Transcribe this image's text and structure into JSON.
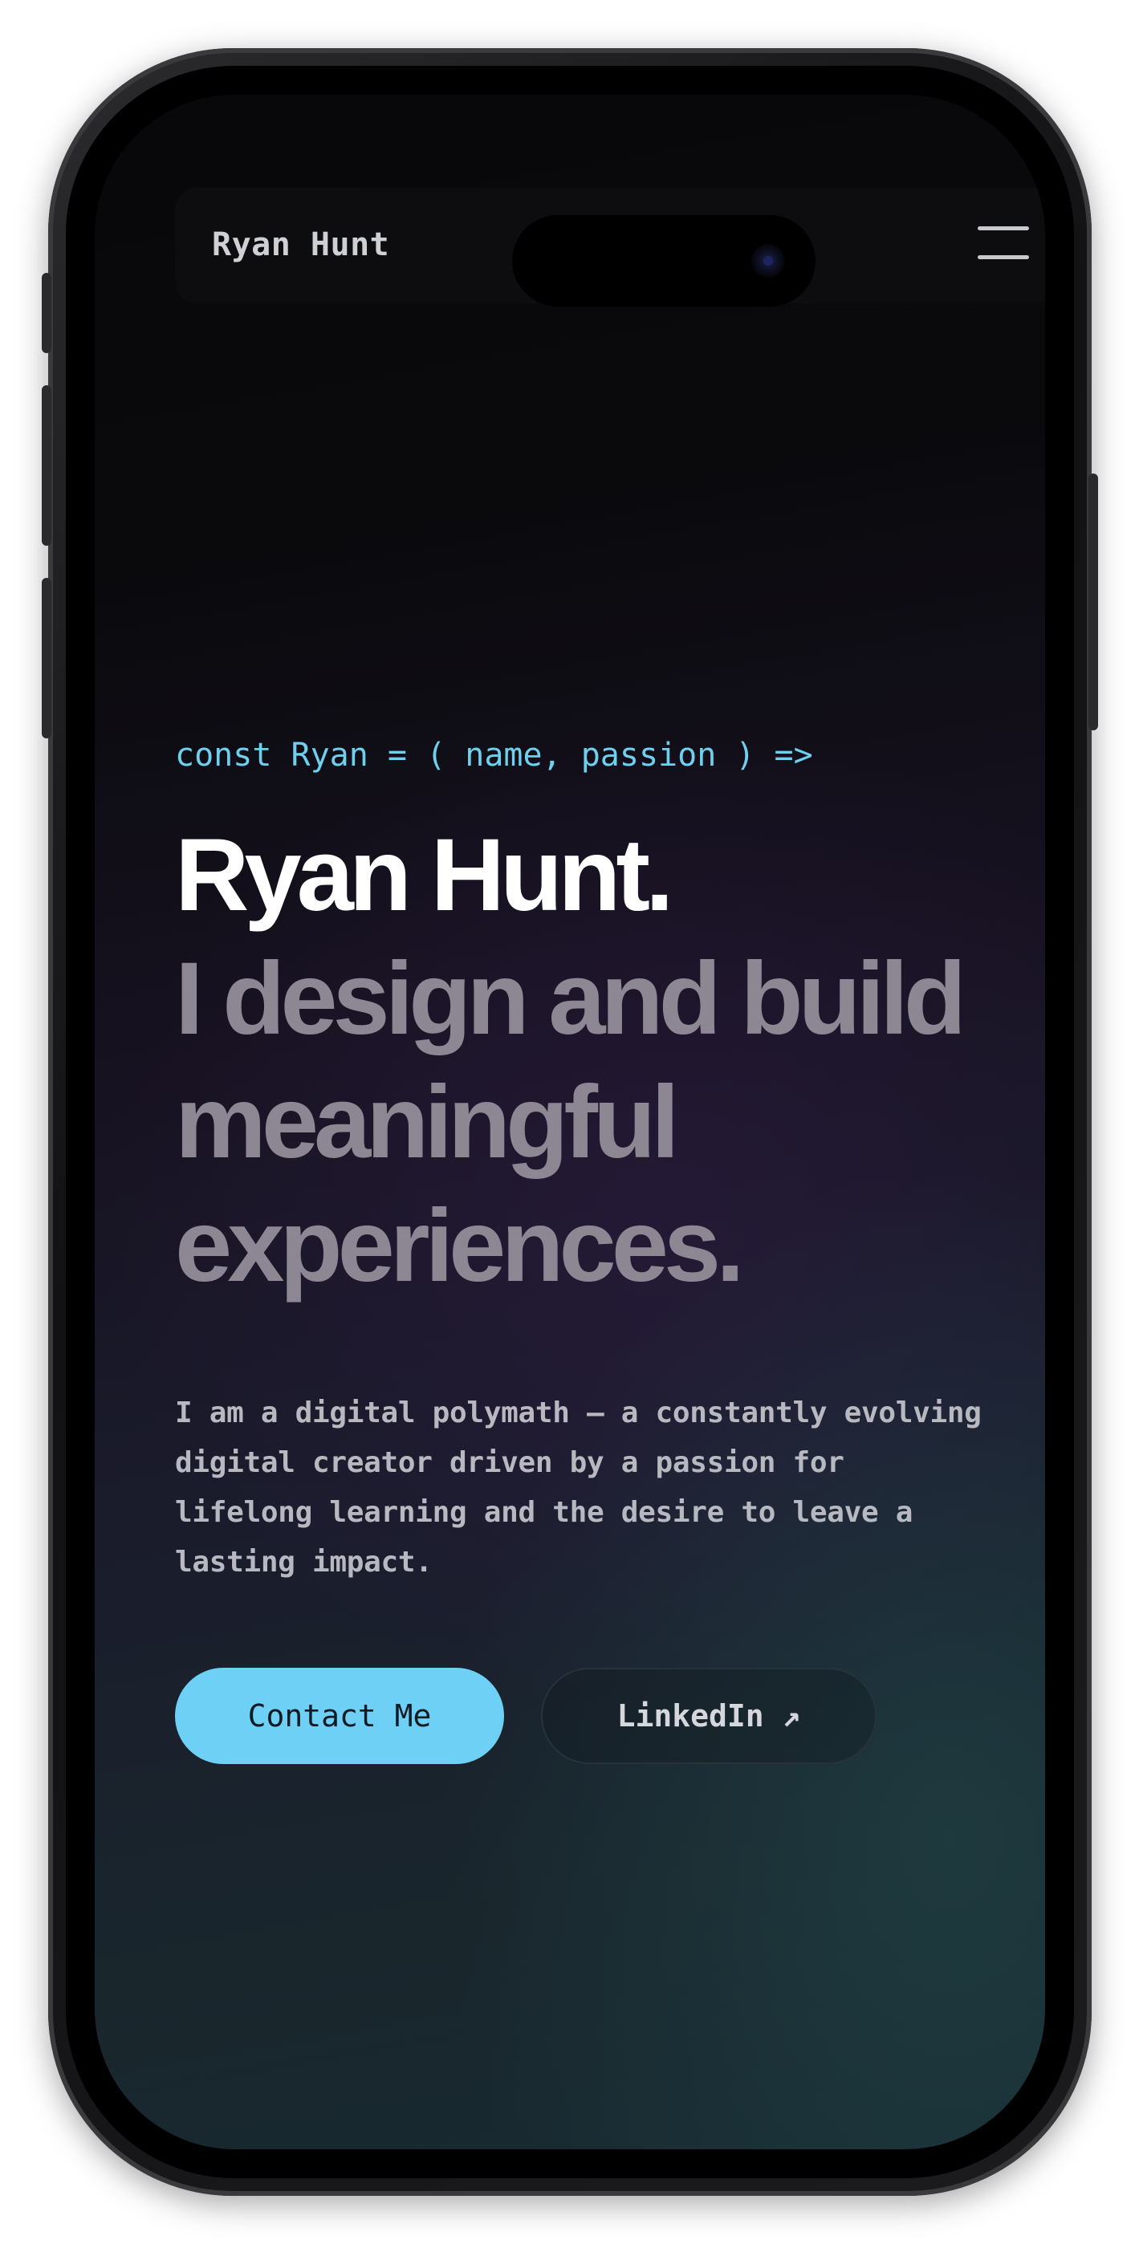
{
  "nav": {
    "brand": "Ryan Hunt"
  },
  "hero": {
    "code_line": "const Ryan = ( name, passion ) =>",
    "name": "Ryan Hunt.",
    "tagline_lines": [
      "I design and build",
      "meaningful",
      "experiences."
    ],
    "intro_lines": [
      "I am a digital polymath — a constantly evolving",
      "digital creator driven by a passion for",
      "lifelong learning and the desire to leave a",
      "lasting impact."
    ]
  },
  "actions": {
    "contact_label": "Contact Me",
    "linkedin_label": "LinkedIn ↗"
  },
  "colors": {
    "accent": "#6fd0f5",
    "code_text": "#6fd0ee",
    "headline_primary": "#ffffff",
    "headline_secondary": "#8c8793"
  },
  "icons": {
    "menu": "hamburger-menu-icon"
  }
}
